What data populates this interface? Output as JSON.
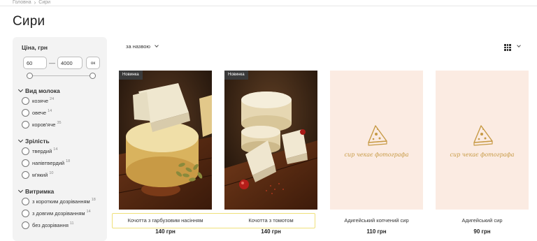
{
  "breadcrumb": {
    "home": "Головна",
    "current": "Сири"
  },
  "page_title": "Сири",
  "filters": {
    "price": {
      "title": "Ціна, грн",
      "min": "60",
      "max": "4000",
      "ok_label": "ок"
    },
    "groups": [
      {
        "title": "Вид молока",
        "options": [
          {
            "label": "козяче",
            "count": "24"
          },
          {
            "label": "овече",
            "count": "14"
          },
          {
            "label": "коров'яче",
            "count": "35"
          }
        ]
      },
      {
        "title": "Зрілість",
        "options": [
          {
            "label": "твердий",
            "count": "14"
          },
          {
            "label": "напівтвердий",
            "count": "18"
          },
          {
            "label": "м'який",
            "count": "10"
          }
        ]
      },
      {
        "title": "Витримка",
        "options": [
          {
            "label": "з коротким дозріванням",
            "count": "18"
          },
          {
            "label": "з довгим дозріванням",
            "count": "14"
          },
          {
            "label": "без дозрівання",
            "count": "11"
          }
        ]
      }
    ]
  },
  "sort": {
    "label": "за назвою"
  },
  "products": [
    {
      "badge": "Новинка",
      "name": "Кочотта з гарбузовим насінням",
      "price": "140 грн"
    },
    {
      "badge": "Новинка",
      "name": "Кочотта з томотом",
      "price": "140 грн"
    },
    {
      "placeholder": "сир чекає фотографа",
      "name": "Адигейський копчений сир",
      "price": "110 грн"
    },
    {
      "placeholder": "сир чекає фотографа",
      "name": "Адигейський сир",
      "price": "90 грн"
    }
  ],
  "colors": {
    "sidebar_bg": "#f3f3f3",
    "placeholder_bg": "#fbebe2",
    "placeholder_accent": "#c79a45",
    "badge_bg": "#3a3a3a",
    "highlight": "#efe07a"
  },
  "icons": {
    "grid_view": "grid-view-icon",
    "chevron": "chevron-down-icon",
    "cheese": "cheese-icon"
  }
}
